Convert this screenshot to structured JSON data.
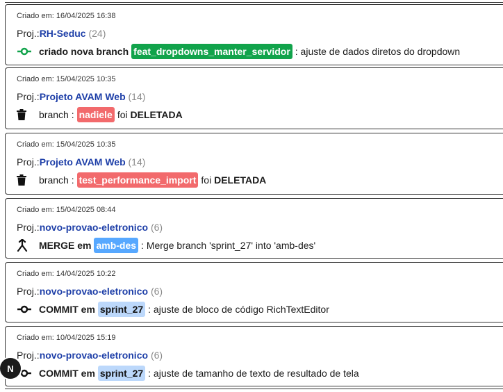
{
  "cards": [
    {
      "date": "Criado em: 16/04/2025 16:38",
      "proj_prefix": "Proj.:",
      "proj_name": "RH-Seduc",
      "proj_count": "(24)",
      "action": "criado nova branch",
      "tag": "feat_dropdowns_manter_servidor",
      "suffix": ": ajuste de dados diretos do dropdown"
    },
    {
      "date": "Criado em: 15/04/2025 10:35",
      "proj_prefix": "Proj.:",
      "proj_name": "Projeto AVAM Web",
      "proj_count": "(14)",
      "action": "branch :",
      "tag": "nadiele",
      "suffix_plain": "foi",
      "suffix_bold": "DELETADA"
    },
    {
      "date": "Criado em: 15/04/2025 10:35",
      "proj_prefix": "Proj.:",
      "proj_name": "Projeto AVAM Web",
      "proj_count": "(14)",
      "action": "branch :",
      "tag": "test_performance_import",
      "suffix_plain": "foi",
      "suffix_bold": "DELETADA"
    },
    {
      "date": "Criado em: 15/04/2025 08:44",
      "proj_prefix": "Proj.:",
      "proj_name": "novo-provao-eletronico",
      "proj_count": "(6)",
      "action": "MERGE em",
      "tag": "amb-des",
      "suffix": ": Merge branch 'sprint_27' into 'amb-des'"
    },
    {
      "date": "Criado em: 14/04/2025 10:22",
      "proj_prefix": "Proj.:",
      "proj_name": "novo-provao-eletronico",
      "proj_count": "(6)",
      "action": "COMMIT em",
      "tag": "sprint_27",
      "suffix": ": ajuste de bloco de código RichTextEditor"
    },
    {
      "date": "Criado em: 10/04/2025 15:19",
      "proj_prefix": "Proj.:",
      "proj_name": "novo-provao-eletronico",
      "proj_count": "(6)",
      "action": "COMMIT em",
      "tag": "sprint_27",
      "suffix": ": ajuste de tamanho de texto de resultado de tela"
    }
  ],
  "avatar": {
    "initial": "N"
  },
  "colors": {
    "green": "#11a34b",
    "red": "#f26a6c",
    "blue": "#57a8ff",
    "lightblue": "#bcd8fb",
    "link": "#1e3fa8"
  }
}
